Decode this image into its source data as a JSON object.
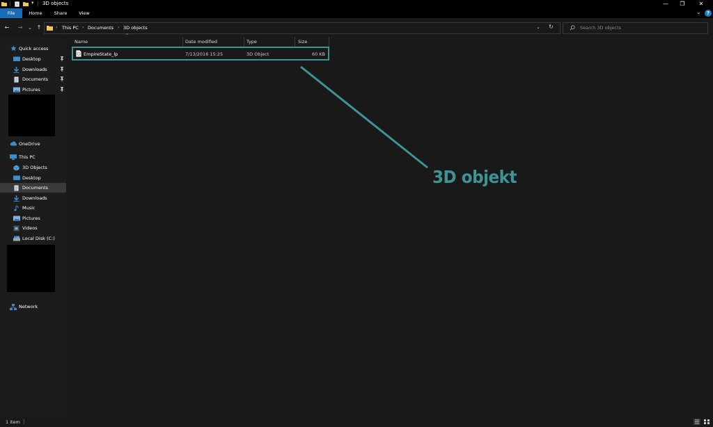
{
  "window": {
    "title": "3D objects",
    "qat_sep": "|",
    "qat_dropdown": "▾",
    "minimize": "—",
    "maximize": "❐",
    "close": "✕",
    "help": "?",
    "ribbon_expand": "⌄"
  },
  "ribbon": {
    "tabs": [
      "File",
      "Home",
      "Share",
      "View"
    ]
  },
  "nav": {
    "back": "←",
    "forward": "→",
    "recent": "⌄",
    "up": "↑",
    "refresh": "↻",
    "dropdown": "⌄"
  },
  "address": {
    "breadcrumbs": [
      "This PC",
      "Documents",
      "3D objects"
    ],
    "separator": "›"
  },
  "search": {
    "placeholder": "Search 3D objects"
  },
  "sidebar": {
    "quick_access": {
      "label": "Quick access",
      "items": [
        {
          "label": "Desktop",
          "pinned": true
        },
        {
          "label": "Downloads",
          "pinned": true
        },
        {
          "label": "Documents",
          "pinned": true
        },
        {
          "label": "Pictures",
          "pinned": true
        }
      ]
    },
    "onedrive": "OneDrive",
    "this_pc": {
      "label": "This PC",
      "items": [
        {
          "label": "3D Objects"
        },
        {
          "label": "Desktop"
        },
        {
          "label": "Documents",
          "selected": true
        },
        {
          "label": "Downloads"
        },
        {
          "label": "Music"
        },
        {
          "label": "Pictures"
        },
        {
          "label": "Videos"
        },
        {
          "label": "Local Disk (C:)"
        }
      ]
    },
    "network": "Network",
    "pin_glyph": "📌"
  },
  "columns": {
    "name": "Name",
    "date_modified": "Date modified",
    "type": "Type",
    "size": "Size",
    "sort_indicator": "^"
  },
  "files": [
    {
      "name": "EmpireState_lp",
      "date_modified": "7/13/2016 15:25",
      "type": "3D Object",
      "size": "60 KB"
    }
  ],
  "annotation": {
    "text": "3D objekt",
    "color": "#3d9494"
  },
  "status": {
    "item_count": "1 item",
    "separator": "|"
  },
  "colors": {
    "background": "#191919",
    "sidebar": "#1c1c1c",
    "accent": "#1a6bb5",
    "selected": "#3a3a3a"
  }
}
